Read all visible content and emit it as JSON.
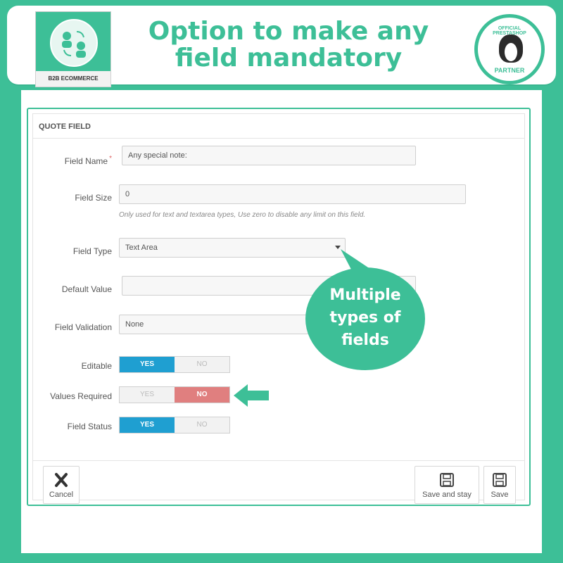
{
  "banner": {
    "headline_line1": "Option to make any",
    "headline_line2": "field mandatory",
    "logo_caption": "B2B ECOMMERCE",
    "badge_top": "OFFICIAL PRESTASHOP",
    "badge_bottom": "PARTNER"
  },
  "panel": {
    "heading": "QUOTE FIELD"
  },
  "form": {
    "field_name_label": "Field Name",
    "field_name_required": "*",
    "field_name_value": "Any special note:",
    "field_size_label": "Field Size",
    "field_size_value": "0",
    "field_size_hint": "Only used for text and textarea types, Use zero to disable any limit on this field.",
    "field_type_label": "Field Type",
    "field_type_value": "Text Area",
    "default_value_label": "Default Value",
    "default_value_value": "",
    "field_validation_label": "Field Validation",
    "field_validation_value": "None",
    "editable_label": "Editable",
    "values_required_label": "Values Required",
    "field_status_label": "Field Status",
    "yes": "YES",
    "no": "NO",
    "editable_state": "YES",
    "values_required_state": "NO",
    "field_status_state": "YES"
  },
  "callout": {
    "line1": "Multiple",
    "line2": "types of",
    "line3": "fields"
  },
  "footer": {
    "cancel_label": "Cancel",
    "save_and_stay_label": "Save and stay",
    "save_label": "Save"
  },
  "colors": {
    "brand": "#3dbf97",
    "toggle_yes": "#1f9fd1",
    "toggle_no": "#e07f7f"
  }
}
